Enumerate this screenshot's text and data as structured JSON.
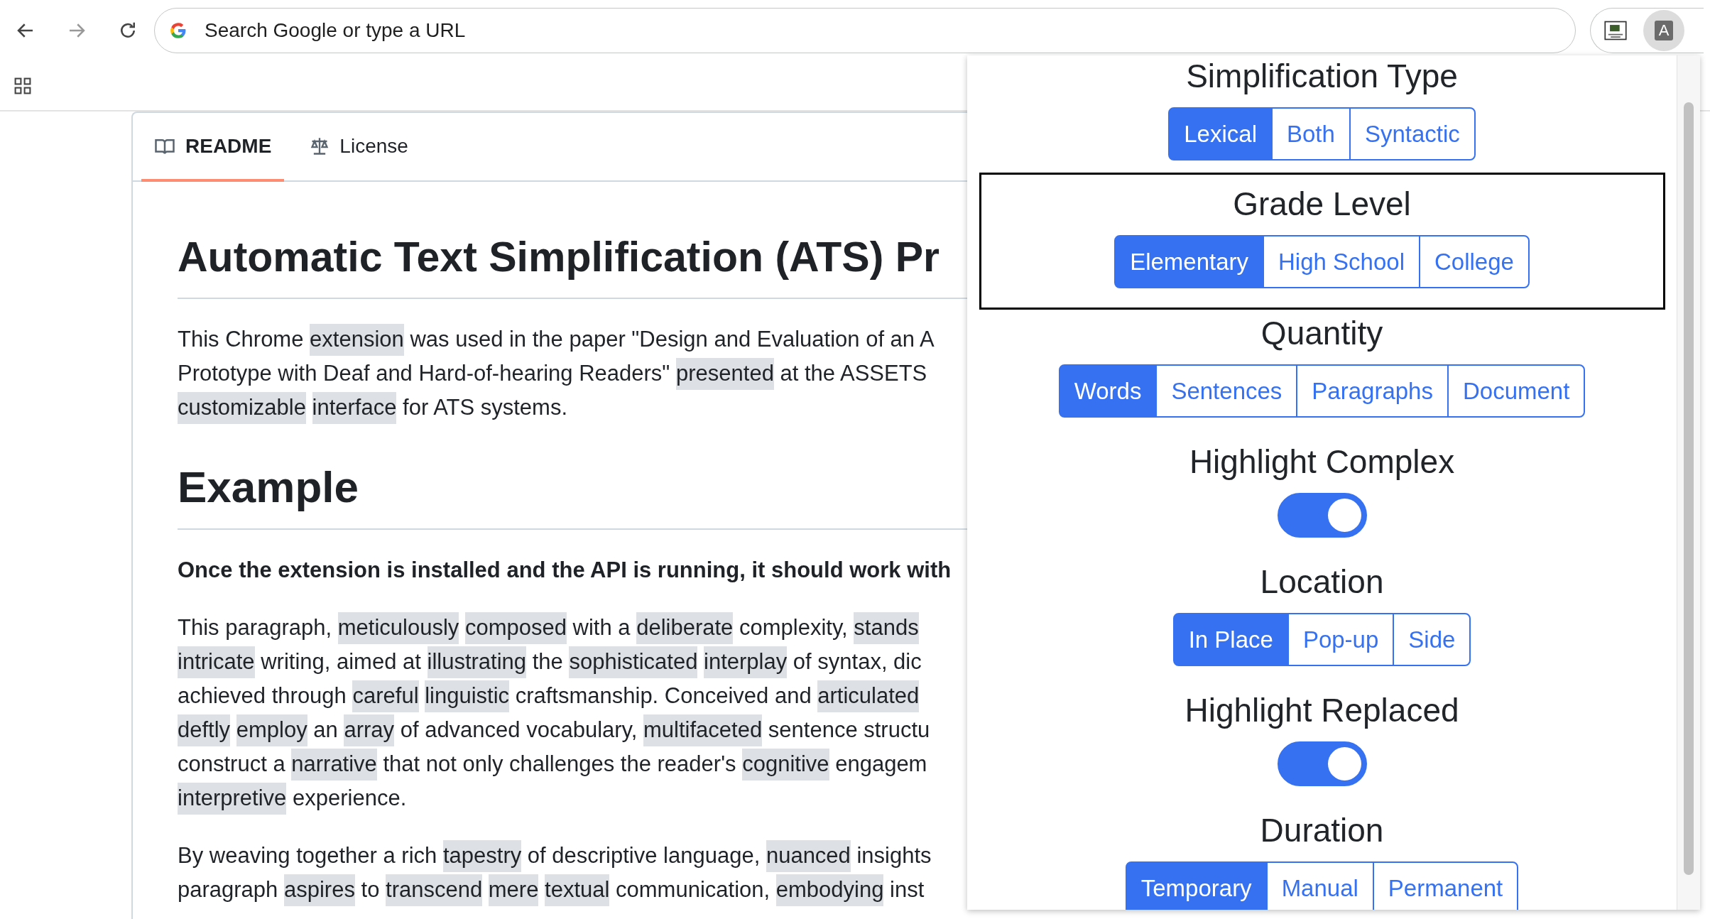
{
  "browser": {
    "address_bar": {
      "placeholder": "Search Google or type a URL"
    },
    "avatar_letter": "A"
  },
  "readme": {
    "tabs": [
      {
        "label": "README",
        "selected": true
      },
      {
        "label": "License",
        "selected": false
      }
    ],
    "title": "Automatic Text Simplification (ATS) Pr",
    "blocks": [
      {
        "kind": "paragraph",
        "lines": [
          [
            {
              "text": "This Chrome",
              "highlighted": false
            },
            {
              "text": "extension",
              "highlighted": true
            },
            {
              "text": "was used in the paper \"Design and Evaluation of an A",
              "highlighted": false
            }
          ],
          [
            {
              "text": "Prototype with Deaf and Hard-of-hearing Readers\"",
              "highlighted": false
            },
            {
              "text": "presented",
              "highlighted": true
            },
            {
              "text": "at the ASSETS",
              "highlighted": false
            }
          ],
          [
            {
              "text": "customizable",
              "highlighted": true
            },
            {
              "text": "interface",
              "highlighted": true
            },
            {
              "text": "for ATS systems.",
              "highlighted": false
            }
          ]
        ]
      },
      {
        "kind": "heading",
        "text": "Example"
      },
      {
        "kind": "bold",
        "text": "Once the extension is installed and the API is running, it should work with"
      },
      {
        "kind": "paragraph",
        "lines": [
          [
            {
              "text": "This paragraph,",
              "highlighted": false
            },
            {
              "text": "meticulously",
              "highlighted": true
            },
            {
              "text": "composed",
              "highlighted": true
            },
            {
              "text": "with a",
              "highlighted": false
            },
            {
              "text": "deliberate",
              "highlighted": true
            },
            {
              "text": "complexity,",
              "highlighted": false
            },
            {
              "text": "stands",
              "highlighted": true
            }
          ],
          [
            {
              "text": "intricate",
              "highlighted": true
            },
            {
              "text": "writing, aimed at",
              "highlighted": false
            },
            {
              "text": "illustrating",
              "highlighted": true
            },
            {
              "text": "the",
              "highlighted": false
            },
            {
              "text": "sophisticated",
              "highlighted": true
            },
            {
              "text": "interplay",
              "highlighted": true
            },
            {
              "text": "of syntax, dic",
              "highlighted": false
            }
          ],
          [
            {
              "text": "achieved through",
              "highlighted": false
            },
            {
              "text": "careful",
              "highlighted": true
            },
            {
              "text": "linguistic",
              "highlighted": true
            },
            {
              "text": "craftsmanship. Conceived and",
              "highlighted": false
            },
            {
              "text": "articulated",
              "highlighted": true
            }
          ],
          [
            {
              "text": "deftly",
              "highlighted": true
            },
            {
              "text": "employ",
              "highlighted": true
            },
            {
              "text": "an",
              "highlighted": false
            },
            {
              "text": "array",
              "highlighted": true
            },
            {
              "text": "of advanced vocabulary,",
              "highlighted": false
            },
            {
              "text": "multifaceted",
              "highlighted": true
            },
            {
              "text": "sentence structu",
              "highlighted": false
            }
          ],
          [
            {
              "text": "construct a",
              "highlighted": false
            },
            {
              "text": "narrative",
              "highlighted": true
            },
            {
              "text": "that not only challenges the reader's",
              "highlighted": false
            },
            {
              "text": "cognitive",
              "highlighted": true
            },
            {
              "text": "engagem",
              "highlighted": false
            }
          ],
          [
            {
              "text": "interpretive",
              "highlighted": true
            },
            {
              "text": "experience.",
              "highlighted": false
            }
          ]
        ]
      },
      {
        "kind": "paragraph",
        "lines": [
          [
            {
              "text": "By weaving together a rich",
              "highlighted": false
            },
            {
              "text": "tapestry",
              "highlighted": true
            },
            {
              "text": "of descriptive language,",
              "highlighted": false
            },
            {
              "text": "nuanced",
              "highlighted": true
            },
            {
              "text": "insights",
              "highlighted": false
            }
          ],
          [
            {
              "text": "paragraph",
              "highlighted": false
            },
            {
              "text": "aspires",
              "highlighted": true
            },
            {
              "text": "to",
              "highlighted": false
            },
            {
              "text": "transcend",
              "highlighted": true
            },
            {
              "text": "mere",
              "highlighted": true
            },
            {
              "text": "textual",
              "highlighted": true
            },
            {
              "text": "communication,",
              "highlighted": false
            },
            {
              "text": "embodying",
              "highlighted": true
            },
            {
              "text": "inst",
              "highlighted": false
            }
          ]
        ]
      }
    ]
  },
  "popup": {
    "sections": [
      {
        "title": "Simplification Type",
        "kind": "buttons",
        "focused": false,
        "options": [
          {
            "label": "Lexical",
            "selected": true
          },
          {
            "label": "Both",
            "selected": false
          },
          {
            "label": "Syntactic",
            "selected": false
          }
        ]
      },
      {
        "title": "Grade Level",
        "kind": "buttons",
        "focused": true,
        "options": [
          {
            "label": "Elementary",
            "selected": true
          },
          {
            "label": "High School",
            "selected": false
          },
          {
            "label": "College",
            "selected": false
          }
        ]
      },
      {
        "title": "Quantity",
        "kind": "buttons",
        "focused": false,
        "options": [
          {
            "label": "Words",
            "selected": true
          },
          {
            "label": "Sentences",
            "selected": false
          },
          {
            "label": "Paragraphs",
            "selected": false
          },
          {
            "label": "Document",
            "selected": false
          }
        ]
      },
      {
        "title": "Highlight Complex",
        "kind": "toggle",
        "focused": false,
        "on": true
      },
      {
        "title": "Location",
        "kind": "buttons",
        "focused": false,
        "options": [
          {
            "label": "In Place",
            "selected": true
          },
          {
            "label": "Pop-up",
            "selected": false
          },
          {
            "label": "Side",
            "selected": false
          }
        ]
      },
      {
        "title": "Highlight Replaced",
        "kind": "toggle",
        "focused": false,
        "on": true
      },
      {
        "title": "Duration",
        "kind": "buttons",
        "focused": false,
        "options": [
          {
            "label": "Temporary",
            "selected": true
          },
          {
            "label": "Manual",
            "selected": false
          },
          {
            "label": "Permanent",
            "selected": false
          }
        ]
      }
    ]
  }
}
